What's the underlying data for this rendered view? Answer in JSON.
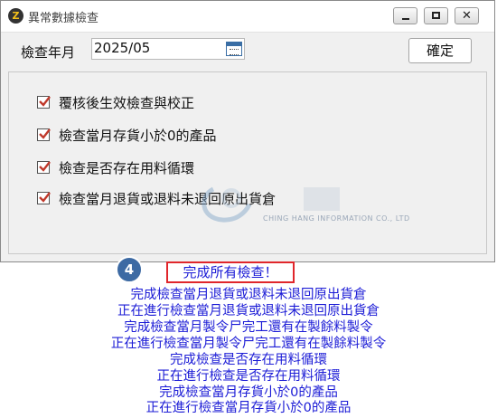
{
  "window": {
    "title": "異常數據檢查",
    "app_icon_glyph": "Z"
  },
  "titlebar_controls": {
    "minimize": "minimize-icon",
    "maximize": "maximize-icon",
    "close_glyph": "✕"
  },
  "form": {
    "date_label": "檢查年月",
    "date_value": "2025/05",
    "confirm_label": "確定"
  },
  "checks": [
    {
      "label": "覆核後生效檢查與校正",
      "checked": true
    },
    {
      "label": "檢查當月存貨小於0的產品",
      "checked": true
    },
    {
      "label": "檢查是否存在用料循環",
      "checked": true
    },
    {
      "label": "檢查當月退貨或退料未退回原出貨倉",
      "checked": true
    }
  ],
  "watermark": {
    "text": "CHING HANG INFORMATION CO., LTD"
  },
  "step": {
    "number": "4"
  },
  "log": {
    "done_message": "完成所有檢查！",
    "lines": [
      "完成檢查當月退貨或退料未退回原出貨倉",
      "正在進行檢查當月退貨或退料未退回原出貨倉",
      "完成檢查當月製令尸完工還有在製餘料製令",
      "正在進行檢查當月製令尸完工還有在製餘料製令",
      "完成檢查是否存在用料循環",
      "正在進行檢查是否存在用料循環",
      "完成檢查當月存貨小於0的產品",
      "正在進行檢查當月存貨小於0的產品"
    ]
  },
  "colors": {
    "log_text": "#1c1cd6",
    "highlight_border": "#e0262b",
    "badge": "#3d6aa3",
    "check_mark": "#c0392b"
  }
}
